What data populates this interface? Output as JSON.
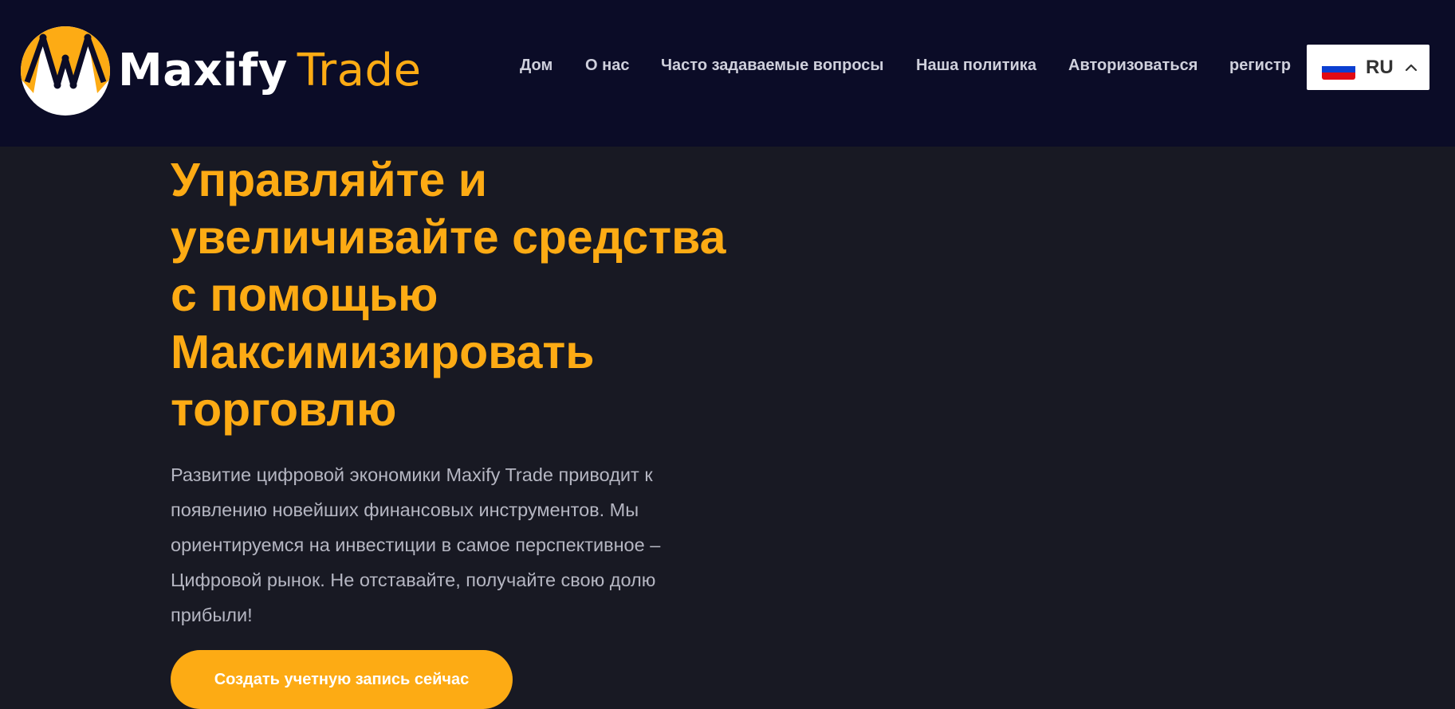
{
  "brand": {
    "name_part1": "Maxify",
    "name_part2": "Trade",
    "colors": {
      "accent": "#fdab14",
      "header_bg": "#0b0c27",
      "page_bg": "#181923"
    }
  },
  "nav": {
    "items": [
      {
        "label": "Дом"
      },
      {
        "label": "О нас"
      },
      {
        "label": "Часто задаваемые вопросы"
      },
      {
        "label": "Наша политика"
      },
      {
        "label": "Авторизоваться"
      },
      {
        "label": "регистр"
      }
    ]
  },
  "language": {
    "code": "RU",
    "flag_icon": "russia-flag-icon",
    "chevron_icon": "chevron-up-icon"
  },
  "hero": {
    "title": "Управляйте и увеличивайте средства с помощью Максимизировать торговлю",
    "text": "Развитие цифровой экономики Maxify Trade приводит к появлению новейших финансовых инструментов. Мы ориентируемся на инвестиции в самое перспективное – Цифровой рынок. Не отставайте, получайте свою долю прибыли!",
    "cta_label": "Создать учетную запись сейчас"
  }
}
